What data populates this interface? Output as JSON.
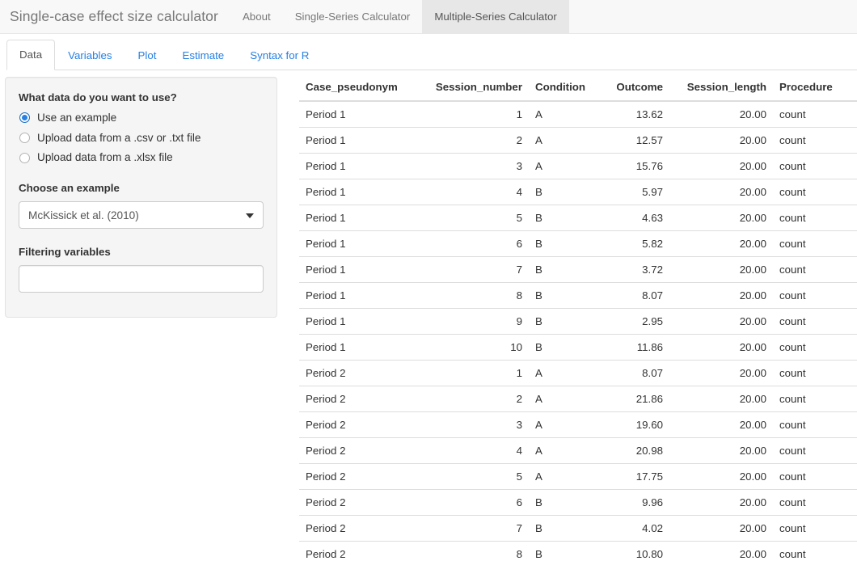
{
  "navbar": {
    "brand": "Single-case effect size calculator",
    "items": [
      {
        "label": "About",
        "active": false
      },
      {
        "label": "Single-Series Calculator",
        "active": false
      },
      {
        "label": "Multiple-Series Calculator",
        "active": true
      }
    ]
  },
  "tabs": [
    {
      "label": "Data",
      "active": true
    },
    {
      "label": "Variables",
      "active": false
    },
    {
      "label": "Plot",
      "active": false
    },
    {
      "label": "Estimate",
      "active": false
    },
    {
      "label": "Syntax for R",
      "active": false
    }
  ],
  "sidebar": {
    "data_source_label": "What data do you want to use?",
    "radios": [
      {
        "label": "Use an example",
        "checked": true
      },
      {
        "label": "Upload data from a .csv or .txt file",
        "checked": false
      },
      {
        "label": "Upload data from a .xlsx file",
        "checked": false
      }
    ],
    "example_label": "Choose an example",
    "example_value": "McKissick et al. (2010)",
    "filter_label": "Filtering variables",
    "filter_value": "",
    "filter_placeholder": ""
  },
  "table": {
    "columns": [
      "Case_pseudonym",
      "Session_number",
      "Condition",
      "Outcome",
      "Session_length",
      "Procedure"
    ],
    "rows": [
      [
        "Period 1",
        "1",
        "A",
        "13.62",
        "20.00",
        "count"
      ],
      [
        "Period 1",
        "2",
        "A",
        "12.57",
        "20.00",
        "count"
      ],
      [
        "Period 1",
        "3",
        "A",
        "15.76",
        "20.00",
        "count"
      ],
      [
        "Period 1",
        "4",
        "B",
        "5.97",
        "20.00",
        "count"
      ],
      [
        "Period 1",
        "5",
        "B",
        "4.63",
        "20.00",
        "count"
      ],
      [
        "Period 1",
        "6",
        "B",
        "5.82",
        "20.00",
        "count"
      ],
      [
        "Period 1",
        "7",
        "B",
        "3.72",
        "20.00",
        "count"
      ],
      [
        "Period 1",
        "8",
        "B",
        "8.07",
        "20.00",
        "count"
      ],
      [
        "Period 1",
        "9",
        "B",
        "2.95",
        "20.00",
        "count"
      ],
      [
        "Period 1",
        "10",
        "B",
        "11.86",
        "20.00",
        "count"
      ],
      [
        "Period 2",
        "1",
        "A",
        "8.07",
        "20.00",
        "count"
      ],
      [
        "Period 2",
        "2",
        "A",
        "21.86",
        "20.00",
        "count"
      ],
      [
        "Period 2",
        "3",
        "A",
        "19.60",
        "20.00",
        "count"
      ],
      [
        "Period 2",
        "4",
        "A",
        "20.98",
        "20.00",
        "count"
      ],
      [
        "Period 2",
        "5",
        "A",
        "17.75",
        "20.00",
        "count"
      ],
      [
        "Period 2",
        "6",
        "B",
        "9.96",
        "20.00",
        "count"
      ],
      [
        "Period 2",
        "7",
        "B",
        "4.02",
        "20.00",
        "count"
      ],
      [
        "Period 2",
        "8",
        "B",
        "10.80",
        "20.00",
        "count"
      ]
    ]
  },
  "colors": {
    "link": "#2780e3",
    "navbar_bg": "#f8f8f8",
    "navbar_active_bg": "#e7e7e7",
    "well_bg": "#f5f5f5",
    "text": "#333333",
    "muted": "#777777"
  }
}
